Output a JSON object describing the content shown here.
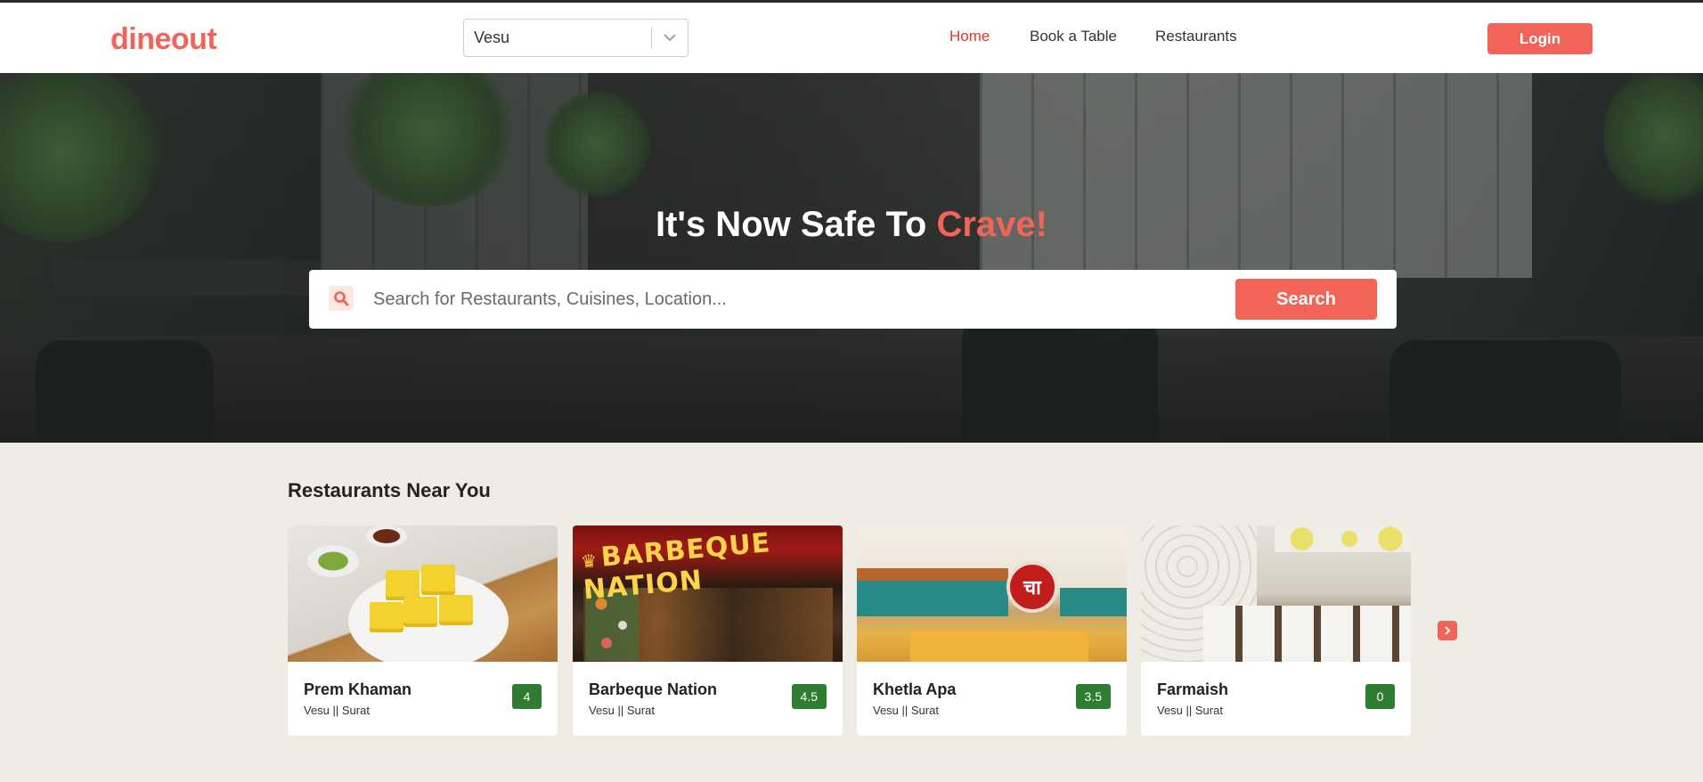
{
  "header": {
    "logo_text": "dineout",
    "city_select": {
      "value": "Vesu",
      "icon": "chevron-down-icon"
    },
    "nav": [
      {
        "label": "Home",
        "active": true
      },
      {
        "label": "Book a Table",
        "active": false
      },
      {
        "label": "Restaurants",
        "active": false
      }
    ],
    "login_label": "Login"
  },
  "hero": {
    "title_prefix": "It's Now Safe To ",
    "title_accent": "Crave!",
    "search": {
      "placeholder": "Search for Restaurants, Cuisines, Location...",
      "value": "",
      "button_label": "Search",
      "icon": "search-icon"
    }
  },
  "section": {
    "title": "Restaurants Near You",
    "restaurants": [
      {
        "name": "Prem Khaman",
        "location": "Vesu || Surat",
        "rating": "4"
      },
      {
        "name": "Barbeque Nation",
        "location": "Vesu || Surat",
        "rating": "4.5",
        "image_sign": "BARBEQUE NATION"
      },
      {
        "name": "Khetla Apa",
        "location": "Vesu || Surat",
        "rating": "3.5",
        "image_logo": "चा"
      },
      {
        "name": "Farmaish",
        "location": "Vesu || Surat",
        "rating": "0"
      }
    ],
    "next_icon": "chevron-right-icon"
  },
  "colors": {
    "brand": "#f26457",
    "nav_active": "#e3362a",
    "rating_bg": "#2e7d32",
    "page_bg": "#eeece4"
  }
}
